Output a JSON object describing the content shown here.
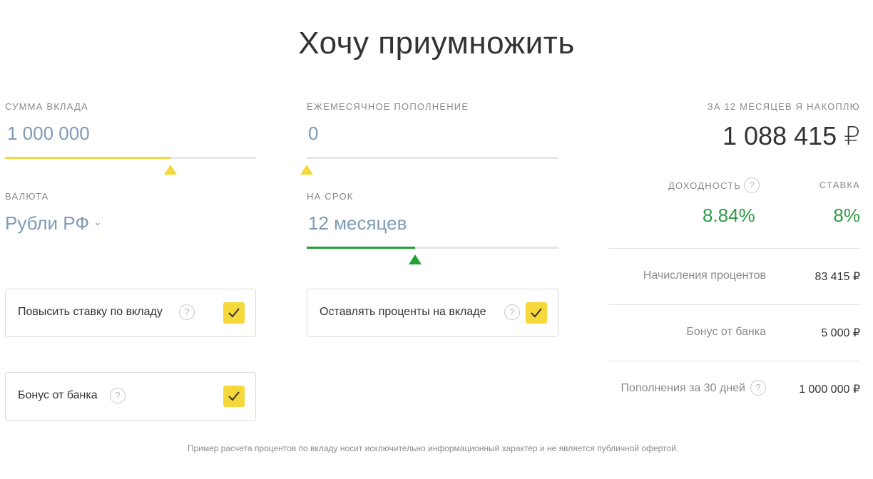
{
  "title": "Хочу приумножить",
  "deposit": {
    "label": "СУММА ВКЛАДА",
    "value": "1 000 000",
    "slider_fraction": 0.66
  },
  "monthly": {
    "label": "ЕЖЕМЕСЯЧНОЕ ПОПОЛНЕНИЕ",
    "value": "0",
    "slider_fraction": 0
  },
  "currency": {
    "label": "ВАЛЮТА",
    "value": "Рубли РФ"
  },
  "term": {
    "label": "НА СРОК",
    "value": "12 месяцев",
    "slider_fraction": 0.43
  },
  "options": {
    "raise_rate": {
      "label": "Повысить ставку по вкладу",
      "help": "?",
      "checked": true
    },
    "keep_interest": {
      "label": "Оставлять проценты на вкладе",
      "help": "?",
      "checked": true
    },
    "bank_bonus": {
      "label": "Бонус от банка",
      "help": "?",
      "checked": true
    }
  },
  "result": {
    "label": "ЗА 12 МЕСЯЦЕВ Я НАКОПЛЮ",
    "value": "1 088 415 ₽",
    "yield_label": "ДОХОДНОСТЬ",
    "yield_help": "?",
    "yield_value": "8.84%",
    "rate_label": "СТАВКА",
    "rate_value": "8%",
    "rows": [
      {
        "label": "Начисления процентов",
        "value": "83 415 ₽"
      },
      {
        "label": "Бонус от банка",
        "value": "5 000 ₽"
      },
      {
        "label": "Пополнения за 30 дней",
        "help": "?",
        "value": "1 000 000 ₽"
      }
    ]
  },
  "disclaimer": "Пример расчета процентов по вкладу носит исключительно информационный характер и не является публичной офертой.",
  "colors": {
    "accent_yellow": "#f6d83a",
    "accent_green": "#21a038",
    "input_blue": "#7f9bb6",
    "positive_green": "#2e9b47"
  }
}
